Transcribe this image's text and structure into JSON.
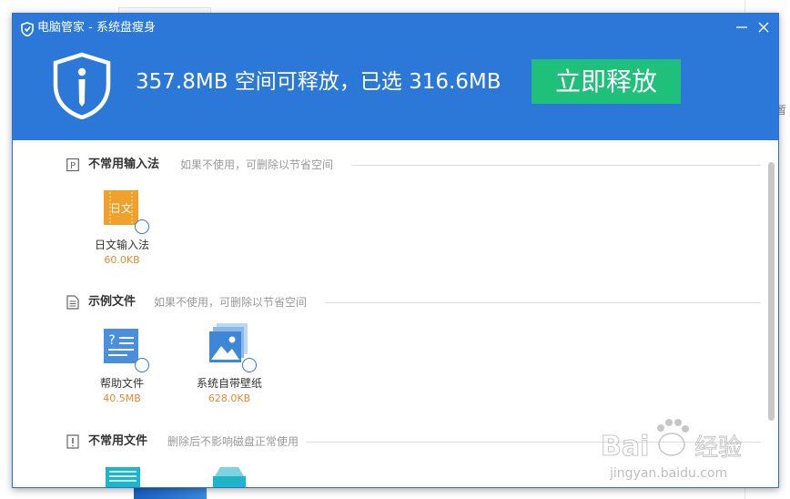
{
  "window": {
    "title": "电脑管家 - 系统盘瘦身"
  },
  "header": {
    "summary": "357.8MB 空间可释放，已选 316.6MB",
    "release_button": "立即释放"
  },
  "sections": [
    {
      "title": "不常用输入法",
      "desc": "如果不使用，可删除以节省空间",
      "items": [
        {
          "name": "日文输入法",
          "size": "60.0KB",
          "icon_label": "日文",
          "icon": "japanese-ime-icon"
        }
      ]
    },
    {
      "title": "示例文件",
      "desc": "如果不使用，可删除以节省空间",
      "items": [
        {
          "name": "帮助文件",
          "size": "40.5MB",
          "icon": "help-doc-icon"
        },
        {
          "name": "系统自带壁纸",
          "size": "628.0KB",
          "icon": "wallpaper-icon"
        }
      ]
    },
    {
      "title": "不常用文件",
      "desc": "删除后不影响磁盘正常使用",
      "items": []
    }
  ],
  "background": {
    "right_text": "暂"
  },
  "watermark": {
    "text": "Bai du 经验",
    "url": "jingyan.baidu.com"
  },
  "colors": {
    "header": "#2b78d8",
    "release": "#1fc07a",
    "size_text": "#e38a2e"
  }
}
